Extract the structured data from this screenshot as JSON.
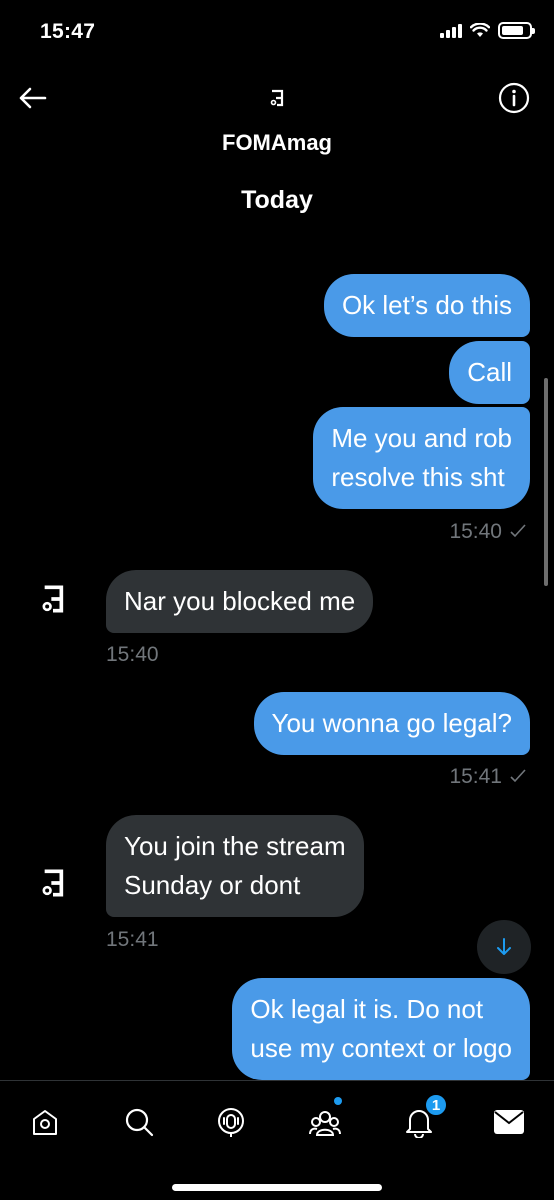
{
  "status": {
    "time": "15:47"
  },
  "header": {
    "name": "FOMAmag",
    "day": "Today"
  },
  "messages": [
    {
      "text": "Ok let’s do this"
    },
    {
      "text": "Call"
    },
    {
      "text": "Me you and rob\nresolve this sht"
    },
    {
      "time": "15:40"
    },
    {
      "text": "Nar you blocked me"
    },
    {
      "time": "15:40"
    },
    {
      "text": "You wonna go legal?"
    },
    {
      "time": "15:41"
    },
    {
      "text": "You join the stream\nSunday or dont"
    },
    {
      "time": "15:41"
    },
    {
      "text": "Ok legal it is. Do not\nuse my context or logo"
    }
  ],
  "tabs": {
    "notifications_badge": "1"
  },
  "colors": {
    "sent_bubble": "#4a9ae8",
    "received_bubble": "#2f3336",
    "accent": "#1d9bf0"
  },
  "icons": [
    "back-arrow-icon",
    "info-icon",
    "home-icon",
    "search-icon",
    "spaces-icon",
    "communities-icon",
    "bell-icon",
    "mail-icon",
    "arrow-down-icon"
  ]
}
